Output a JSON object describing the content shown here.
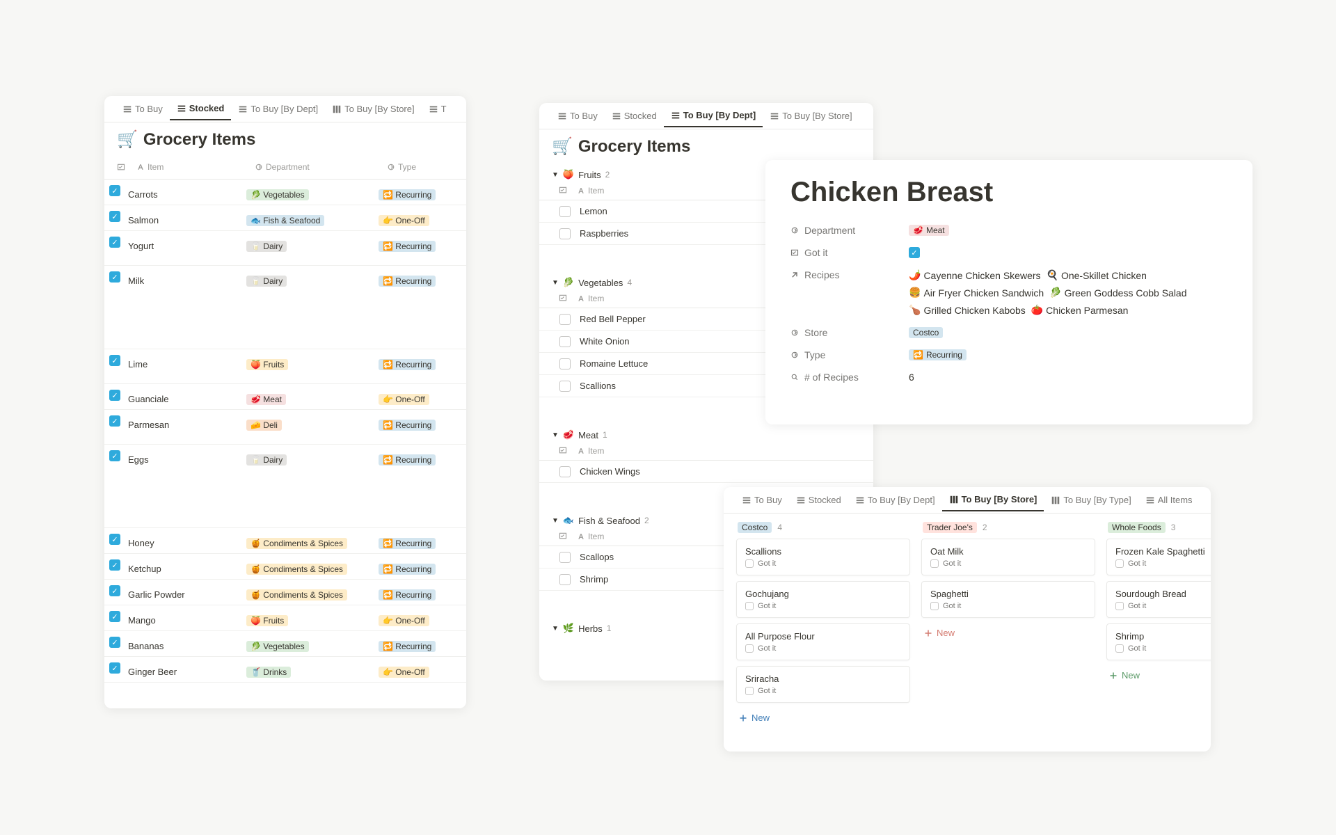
{
  "shared": {
    "tabs": {
      "to_buy": "To Buy",
      "stocked": "Stocked",
      "by_dept": "To Buy [By Dept]",
      "by_store": "To Buy [By Store]",
      "by_type": "To Buy [By Type]",
      "all_items": "All Items",
      "truncated": "T"
    },
    "title_icon": "🛒",
    "title": "Grocery Items",
    "cols": {
      "item": "Item",
      "department": "Department",
      "type": "Type"
    },
    "new_label": "New",
    "got_it": "Got it"
  },
  "panelA": {
    "active_tab": "stocked",
    "rows": [
      {
        "name": "Carrots",
        "checked": true,
        "dept_emoji": "🥬",
        "dept": "Vegetables",
        "dept_class": "tag-veg",
        "type_emoji": "🔁",
        "type": "Recurring",
        "type_class": "tag-recur"
      },
      {
        "name": "Salmon",
        "checked": true,
        "dept_emoji": "🐟",
        "dept": "Fish & Seafood",
        "dept_class": "tag-fish",
        "type_emoji": "👉",
        "type": "One-Off",
        "type_class": "tag-oneoff"
      },
      {
        "name": "Yogurt",
        "checked": true,
        "dept_emoji": "🥛",
        "dept": "Dairy",
        "dept_class": "tag-dairy",
        "type_emoji": "🔁",
        "type": "Recurring",
        "type_class": "tag-recur",
        "tall": true
      },
      {
        "name": "Milk",
        "checked": true,
        "dept_emoji": "🥛",
        "dept": "Dairy",
        "dept_class": "tag-dairy",
        "type_emoji": "🔁",
        "type": "Recurring",
        "type_class": "tag-recur",
        "xtall": true
      },
      {
        "name": "Lime",
        "checked": true,
        "dept_emoji": "🍑",
        "dept": "Fruits",
        "dept_class": "tag-fruit",
        "type_emoji": "🔁",
        "type": "Recurring",
        "type_class": "tag-recur",
        "tall": true
      },
      {
        "name": "Guanciale",
        "checked": true,
        "dept_emoji": "🥩",
        "dept": "Meat",
        "dept_class": "tag-meat",
        "type_emoji": "👉",
        "type": "One-Off",
        "type_class": "tag-oneoff"
      },
      {
        "name": "Parmesan",
        "checked": true,
        "dept_emoji": "🧀",
        "dept": "Deli",
        "dept_class": "tag-deli",
        "type_emoji": "🔁",
        "type": "Recurring",
        "type_class": "tag-recur",
        "tall": true
      },
      {
        "name": "Eggs",
        "checked": true,
        "dept_emoji": "🥛",
        "dept": "Dairy",
        "dept_class": "tag-dairy",
        "type_emoji": "🔁",
        "type": "Recurring",
        "type_class": "tag-recur",
        "xtall": true
      },
      {
        "name": "Honey",
        "checked": true,
        "dept_emoji": "🍯",
        "dept": "Condiments & Spices",
        "dept_class": "tag-cond",
        "type_emoji": "🔁",
        "type": "Recurring",
        "type_class": "tag-recur"
      },
      {
        "name": "Ketchup",
        "checked": true,
        "dept_emoji": "🍯",
        "dept": "Condiments & Spices",
        "dept_class": "tag-cond",
        "type_emoji": "🔁",
        "type": "Recurring",
        "type_class": "tag-recur"
      },
      {
        "name": "Garlic Powder",
        "checked": true,
        "dept_emoji": "🍯",
        "dept": "Condiments & Spices",
        "dept_class": "tag-cond",
        "type_emoji": "🔁",
        "type": "Recurring",
        "type_class": "tag-recur"
      },
      {
        "name": "Mango",
        "checked": true,
        "dept_emoji": "🍑",
        "dept": "Fruits",
        "dept_class": "tag-fruit",
        "type_emoji": "👉",
        "type": "One-Off",
        "type_class": "tag-oneoff"
      },
      {
        "name": "Bananas",
        "checked": true,
        "dept_emoji": "🥬",
        "dept": "Vegetables",
        "dept_class": "tag-veg",
        "type_emoji": "🔁",
        "type": "Recurring",
        "type_class": "tag-recur"
      },
      {
        "name": "Ginger Beer",
        "checked": true,
        "dept_emoji": "🥤",
        "dept": "Drinks",
        "dept_class": "tag-drinks",
        "type_emoji": "👉",
        "type": "One-Off",
        "type_class": "tag-oneoff"
      }
    ]
  },
  "panelB": {
    "active_tab": "by_dept",
    "groups": [
      {
        "emoji": "🍑",
        "name": "Fruits",
        "count": "2",
        "items": [
          "Lemon",
          "Raspberries"
        ]
      },
      {
        "emoji": "🥬",
        "name": "Vegetables",
        "count": "4",
        "items": [
          "Red Bell Pepper",
          "White Onion",
          "Romaine Lettuce",
          "Scallions"
        ]
      },
      {
        "emoji": "🥩",
        "name": "Meat",
        "count": "1",
        "items": [
          "Chicken Wings"
        ]
      },
      {
        "emoji": "🐟",
        "name": "Fish & Seafood",
        "count": "2",
        "items": [
          "Scallops",
          "Shrimp"
        ]
      },
      {
        "emoji": "🌿",
        "name": "Herbs",
        "count": "1",
        "items": []
      }
    ]
  },
  "panelC": {
    "title": "Chicken Breast",
    "props": {
      "department": {
        "label": "Department",
        "emoji": "🥩",
        "value": "Meat"
      },
      "got_it": {
        "label": "Got it",
        "checked": true
      },
      "recipes": {
        "label": "Recipes",
        "items": [
          {
            "emoji": "🌶️",
            "name": "Cayenne Chicken Skewers"
          },
          {
            "emoji": "🍳",
            "name": "One-Skillet Chicken"
          },
          {
            "emoji": "🍔",
            "name": "Air Fryer Chicken Sandwich"
          },
          {
            "emoji": "🥬",
            "name": "Green Goddess Cobb Salad"
          },
          {
            "emoji": "🍗",
            "name": "Grilled Chicken Kabobs"
          },
          {
            "emoji": "🍅",
            "name": "Chicken Parmesan"
          }
        ]
      },
      "store": {
        "label": "Store",
        "value": "Costco"
      },
      "type": {
        "label": "Type",
        "emoji": "🔁",
        "value": "Recurring"
      },
      "nrecipes": {
        "label": "# of Recipes",
        "value": "6"
      }
    }
  },
  "panelD": {
    "active_tab": "by_store",
    "columns": [
      {
        "name": "Costco",
        "class": "tag-store-costco",
        "count": "4",
        "newclass": "blue",
        "cards": [
          "Scallions",
          "Gochujang",
          "All Purpose Flour",
          "Sriracha"
        ]
      },
      {
        "name": "Trader Joe's",
        "class": "tag-store-tj",
        "count": "2",
        "newclass": "red",
        "cards": [
          "Oat Milk",
          "Spaghetti"
        ]
      },
      {
        "name": "Whole Foods",
        "class": "tag-store-wf",
        "count": "3",
        "newclass": "green",
        "cards": [
          "Frozen Kale Spaghetti",
          "Sourdough Bread",
          "Shrimp"
        ]
      }
    ]
  }
}
